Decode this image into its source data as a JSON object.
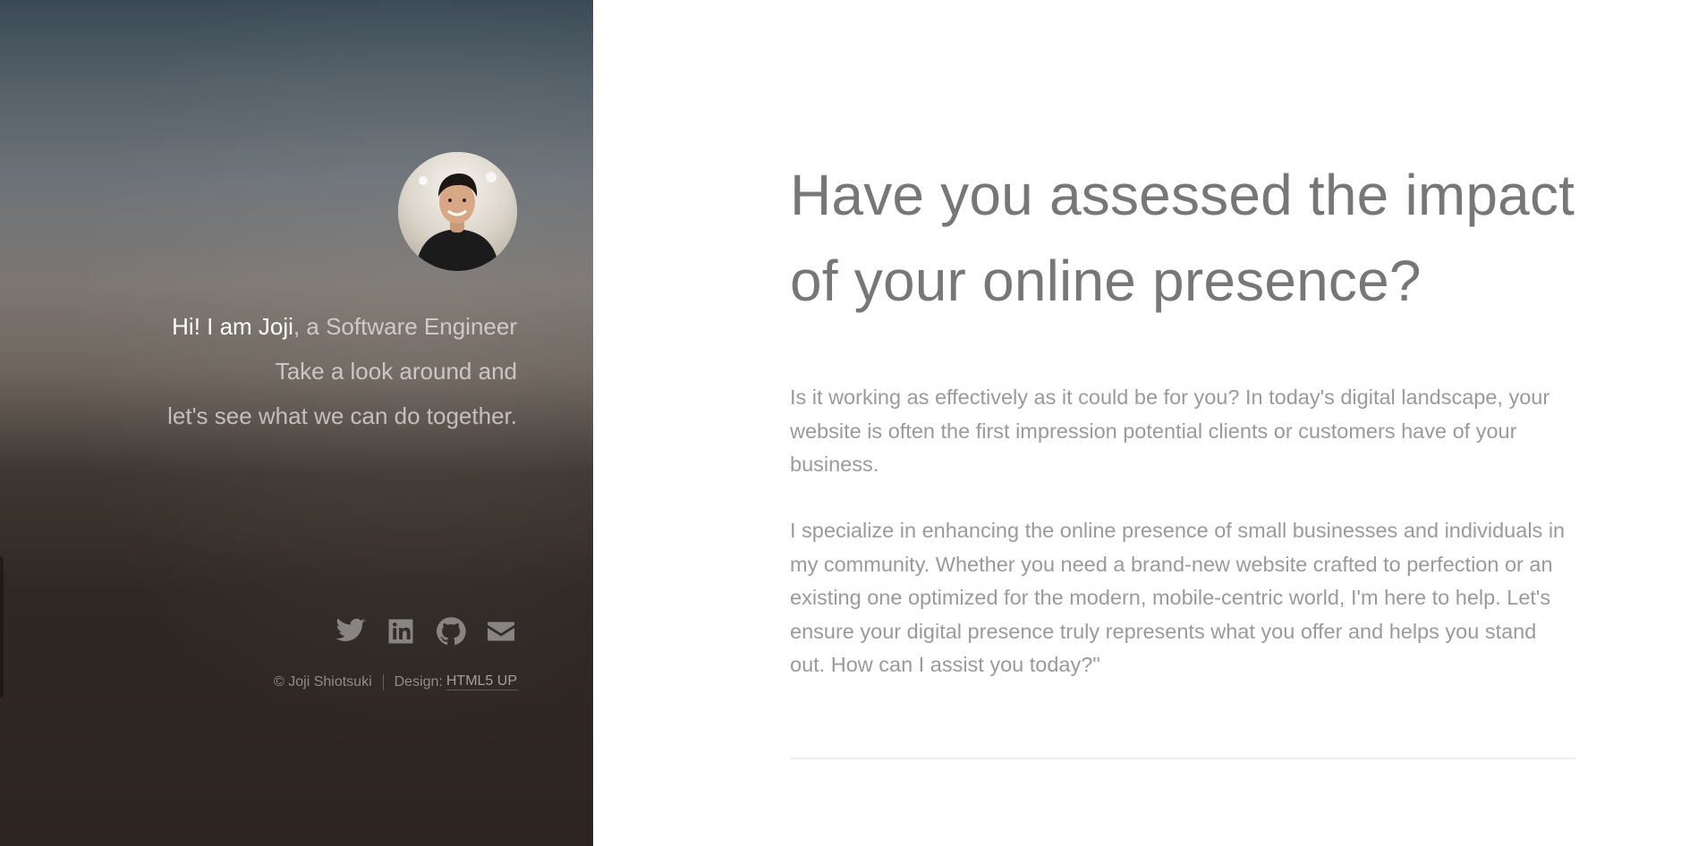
{
  "sidebar": {
    "intro": {
      "greeting": "Hi! I am Joji",
      "role": ", a Software Engineer",
      "line2": "Take a look around and",
      "line3": "let's see what we can do together."
    },
    "social": [
      {
        "name": "twitter-icon"
      },
      {
        "name": "linkedin-icon"
      },
      {
        "name": "github-icon"
      },
      {
        "name": "envelope-icon"
      }
    ],
    "footer": {
      "copyright": "© Joji Shiotsuki",
      "design_label": "Design:",
      "design_link": "HTML5 UP"
    }
  },
  "main": {
    "headline": "Have you assessed the impact of your online presence?",
    "paragraph1": "Is it working as effectively as it could be for you? In today's digital landscape, your website is often the first impression potential clients or customers have of your business.",
    "paragraph2": "I specialize in enhancing the online presence of small businesses and individuals in my community. Whether you need a brand-new website crafted to perfection or an existing one optimized for the modern, mobile-centric world, I'm here to help. Let's ensure your digital presence truly represents what you offer and helps you stand out. How can I assist you today?\""
  },
  "colors": {
    "headline": "#777777",
    "body_text": "#9a9a9a",
    "sidebar_top": "#3a4a55",
    "sidebar_bottom": "#2c2522"
  }
}
